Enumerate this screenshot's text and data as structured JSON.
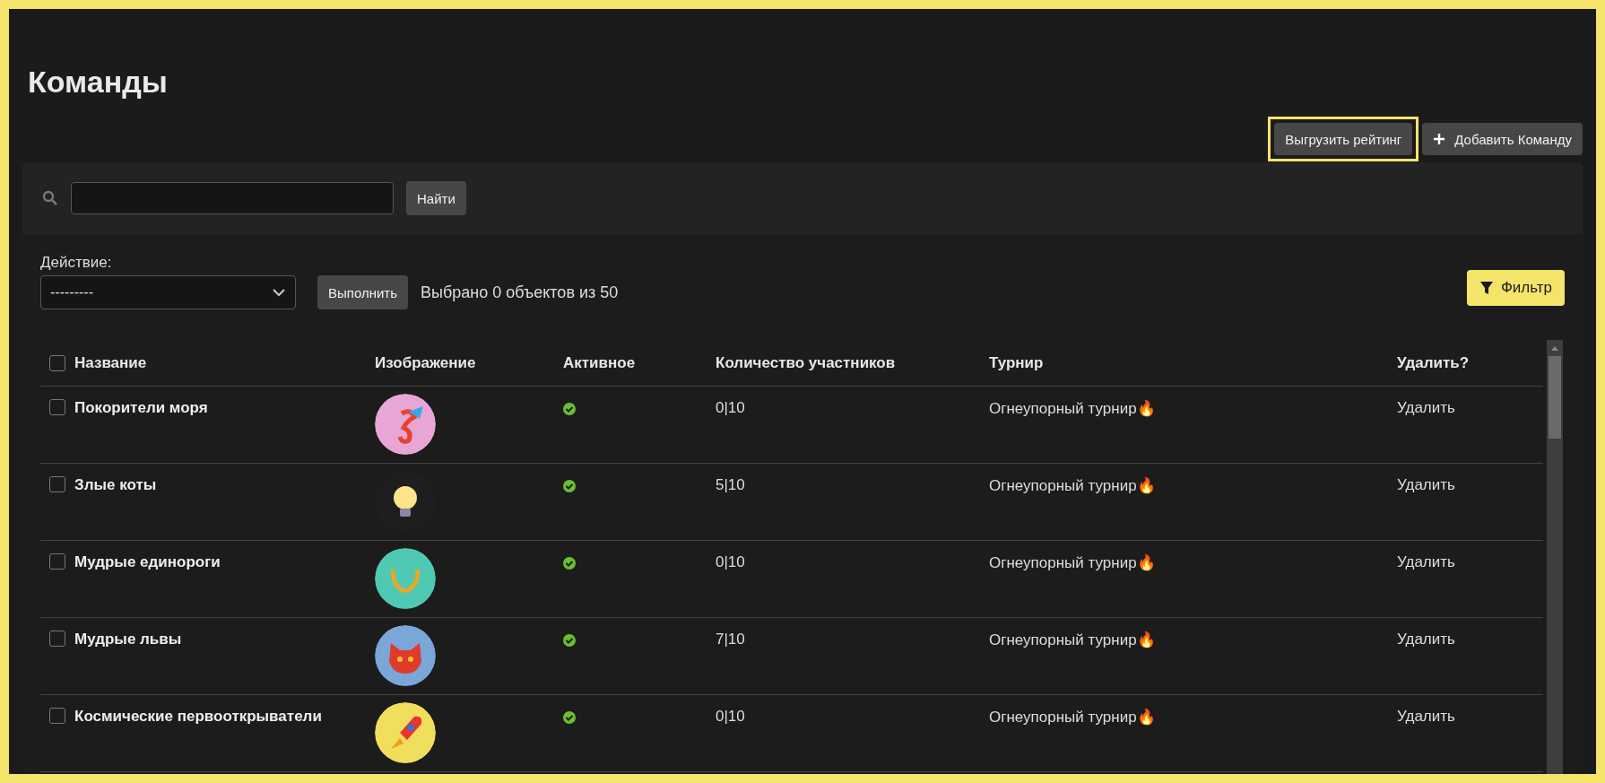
{
  "page_title": "Команды",
  "toolbar_buttons": [
    {
      "label": "Выгрузить рейтинг",
      "kind": "plain",
      "highlighted": true
    },
    {
      "label": "Добавить Команду",
      "kind": "add",
      "highlighted": false
    }
  ],
  "search": {
    "button": "Найти"
  },
  "actions": {
    "label": "Действие:",
    "select_value": "---------",
    "run_button": "Выполнить",
    "selection_info": "Выбрано 0 объектов из 50",
    "filter_button": "Фильтр"
  },
  "table": {
    "columns": [
      "Название",
      "Изображение",
      "Активное",
      "Количество участников",
      "Турнир",
      "Удалить?"
    ],
    "header_checked": false,
    "rows": [
      {
        "checked": false,
        "name": "Покорители моря",
        "kind": "dragon",
        "active": true,
        "members": "0|10",
        "tournament": "Огнеупорный турнир🔥",
        "delete": "Удалить"
      },
      {
        "checked": false,
        "name": "Злые коты",
        "kind": "bulb",
        "active": true,
        "members": "5|10",
        "tournament": "Огнеупорный турнир🔥",
        "delete": "Удалить"
      },
      {
        "checked": false,
        "name": "Мудрые единороги",
        "kind": "laurel",
        "active": true,
        "members": "0|10",
        "tournament": "Огнеупорный турнир🔥",
        "delete": "Удалить"
      },
      {
        "checked": false,
        "name": "Мудрые львы",
        "kind": "cat",
        "active": true,
        "members": "7|10",
        "tournament": "Огнеупорный турнир🔥",
        "delete": "Удалить"
      },
      {
        "checked": false,
        "name": "Космические первооткрыватели",
        "kind": "rocket",
        "active": true,
        "members": "0|10",
        "tournament": "Огнеупорный турнир🔥",
        "delete": "Удалить"
      }
    ]
  }
}
